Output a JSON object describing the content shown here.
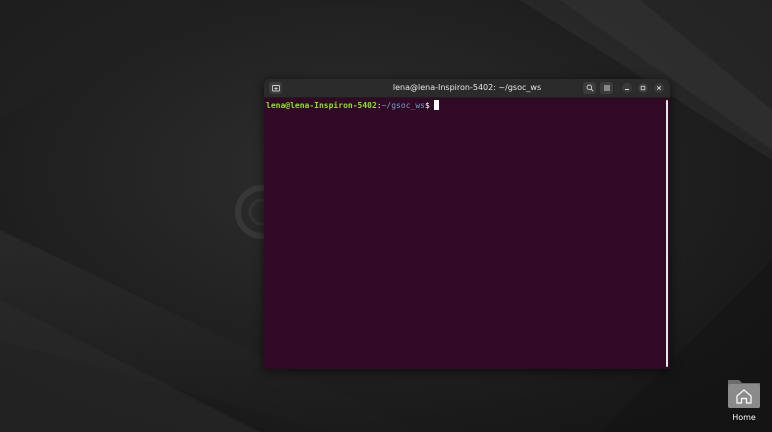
{
  "terminal": {
    "title": "lena@lena-Inspiron-5402: ~/gsoc_ws",
    "prompt": {
      "user_host": "lena@lena-Inspiron-5402",
      "separator": ":",
      "path": "~/gsoc_ws",
      "symbol": "$"
    },
    "icons": {
      "new_tab": "new-tab-icon",
      "search": "search-icon",
      "menu": "hamburger-menu-icon",
      "minimize": "minimize-icon",
      "maximize": "maximize-icon",
      "close": "close-icon"
    },
    "colors": {
      "background": "#300a24",
      "titlebar": "#2b2b2b",
      "user_host": "#8ae234",
      "path": "#729fcf"
    }
  },
  "desktop": {
    "home_folder": {
      "label": "Home",
      "icon": "home-folder-icon"
    },
    "wallpaper": "dark-abstract-wallpaper"
  }
}
